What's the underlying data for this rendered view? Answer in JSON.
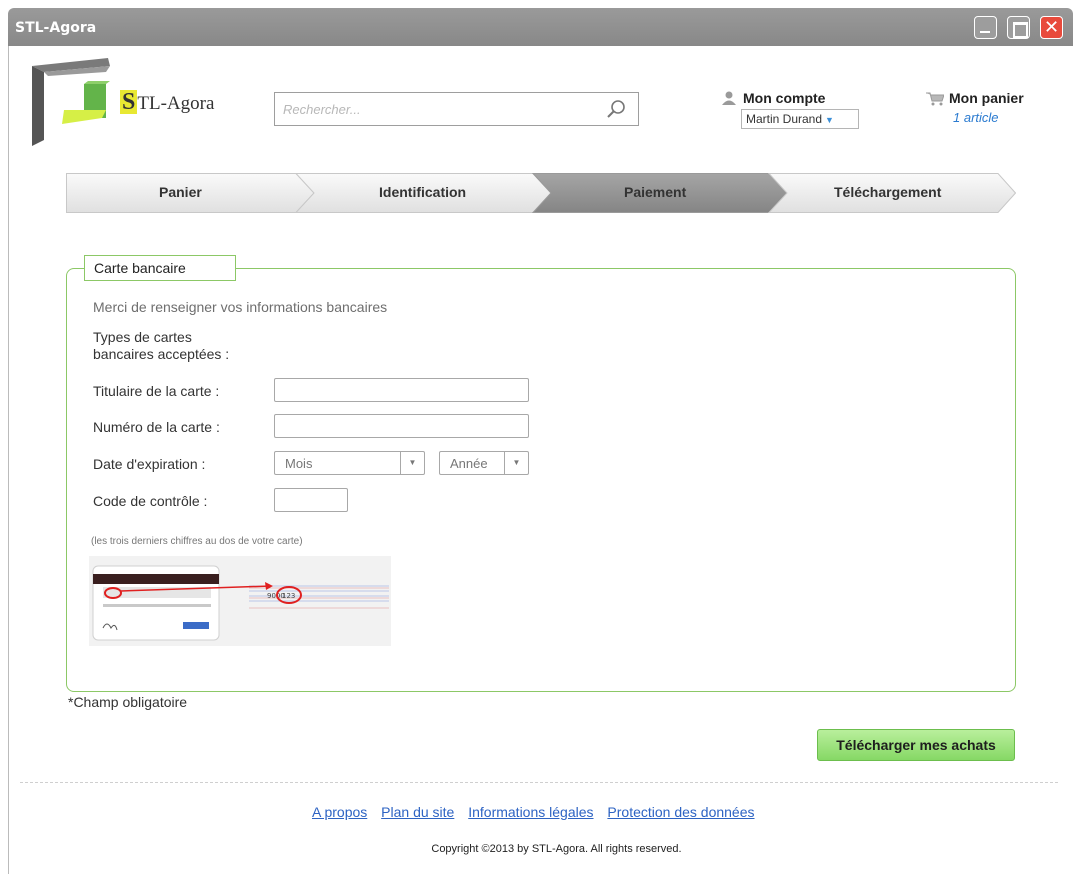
{
  "window": {
    "title": "STL-Agora",
    "close_glyph": "✕"
  },
  "brand": {
    "initial": "S",
    "rest": "TL-Agora"
  },
  "search": {
    "placeholder": "Rechercher...",
    "icon": "magnifier-icon"
  },
  "account": {
    "label": "Mon compte",
    "user": "Martin Durand",
    "icon": "user-icon"
  },
  "cart": {
    "label": "Mon panier",
    "items": "1 article",
    "icon": "cart-icon"
  },
  "steps": [
    {
      "label": "Panier",
      "active": false
    },
    {
      "label": "Identification",
      "active": false
    },
    {
      "label": "Paiement",
      "active": true
    },
    {
      "label": "Téléchargement",
      "active": false
    }
  ],
  "payment": {
    "legend": "Carte bancaire",
    "intro": "Merci de renseigner vos informations bancaires",
    "types_label_line1": "Types de cartes",
    "types_label_line2": "bancaires acceptées :",
    "holder_label": "Titulaire de la carte :",
    "number_label": "Numéro de la carte :",
    "expiry_label": "Date d'expiration :",
    "month_value": "Mois",
    "year_value": "Année",
    "cvc_label": "Code de contrôle :",
    "cvc_hint": "(les trois derniers chiffres au dos de votre carte)",
    "card_example_code": "123"
  },
  "required_note": "*Champ obligatoire",
  "download_button": "Télécharger mes achats",
  "footer": {
    "links": [
      "A propos",
      "Plan du site",
      "Informations légales",
      "Protection des données"
    ],
    "copyright": "Copyright ©2013 by STL-Agora. All rights reserved."
  },
  "colors": {
    "accent_green": "#8cc866",
    "active_step": "#8e8e8e",
    "link_blue": "#2d63c3"
  }
}
